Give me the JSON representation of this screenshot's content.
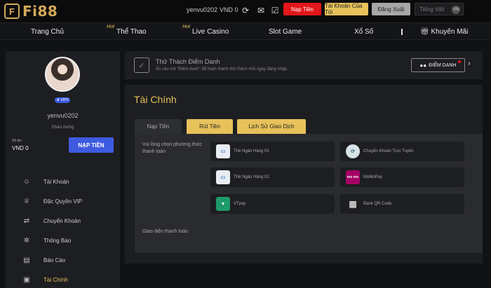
{
  "header": {
    "logo_text": "Fi88",
    "username": "yenvu0202",
    "balance": "VND 0",
    "deposit_button": "Nạp Tiền",
    "account_button": "Tài Khoản Của Tôi",
    "logout_button": "Đăng Xuất",
    "language": "Tiếng Việt",
    "language_code": "VN"
  },
  "nav": {
    "items": [
      {
        "label": "Trang Chủ",
        "hot": ""
      },
      {
        "label": "Thể Thao",
        "hot": "Hot"
      },
      {
        "label": "Live Casino",
        "hot": "Hot"
      },
      {
        "label": "Slot Game",
        "hot": ""
      },
      {
        "label": "Xổ Số",
        "hot": ""
      },
      {
        "label": "Khuyến Mãi",
        "hot": ""
      }
    ]
  },
  "sidebar": {
    "vip_badge": "VIP0",
    "username": "yenvu0202",
    "welcome": "Chào mừng",
    "balance_label": "Số dư",
    "balance_value": "VND 0",
    "deposit_button": "NẠP TIỀN",
    "menu": [
      {
        "label": "Tài Khoản",
        "icon": "user-icon"
      },
      {
        "label": "Đặc Quyền VIP",
        "icon": "crown-icon"
      },
      {
        "label": "Chuyển Khoản",
        "icon": "transfer-icon"
      },
      {
        "label": "Thông Báo",
        "icon": "bell-icon"
      },
      {
        "label": "Báo Cáo",
        "icon": "report-icon"
      },
      {
        "label": "Tài Chính",
        "icon": "wallet-icon"
      }
    ]
  },
  "challenge": {
    "title": "Thử Thách Điểm Danh",
    "subtitle": "Ấn vào nút \"Điểm danh\" để hoàn thành thử thách mỗi ngày đăng nhập.",
    "button": "ĐIỂM DANH"
  },
  "finance": {
    "title": "Tài Chính",
    "tabs": [
      "Nạp Tiền",
      "Rút Tiền",
      "Lịch Sử Giao Dịch"
    ],
    "prompt": "Vui lòng chọn phương thức thanh toán",
    "methods": [
      {
        "label": "Thẻ Ngân Hàng 01",
        "icon": "bank-card-icon"
      },
      {
        "label": "Chuyển Khoản Trực Tuyến",
        "icon": "online-transfer-icon"
      },
      {
        "label": "Thẻ Ngân Hàng 02",
        "icon": "bank-card-icon"
      },
      {
        "label": "MoMoPay",
        "icon": "momo-icon",
        "icon_text": "mo mo"
      },
      {
        "label": "VTpay",
        "icon": "vtpay-icon"
      },
      {
        "label": "Bank QR Code",
        "icon": "qr-code-icon"
      }
    ],
    "footer": "Giao diện thanh toán"
  },
  "colors": {
    "gold": "#e7c15a",
    "red": "#e3161b",
    "blue": "#3e5be0"
  }
}
